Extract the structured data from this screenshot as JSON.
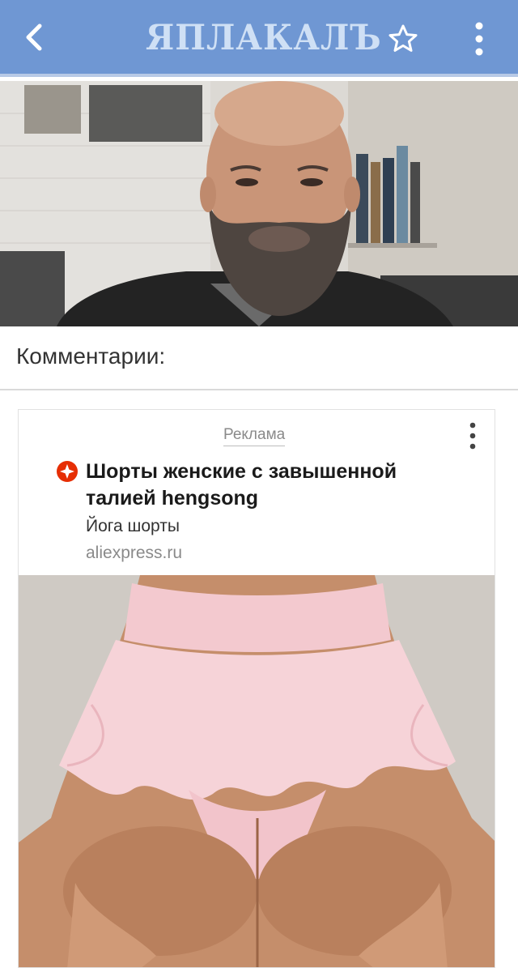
{
  "header": {
    "logo_text": "ЯПЛАКАЛЪ",
    "back_icon": "chevron-left-icon",
    "favorite_icon": "star-outline-icon",
    "menu_icon": "more-vertical-icon",
    "background_color": "#6f97d3"
  },
  "post": {
    "image_alt": "bearded man photo"
  },
  "comments": {
    "title": "Комментарии:"
  },
  "ad": {
    "label": "Реклама",
    "menu_icon": "more-vertical-icon",
    "brand_icon": "aliexpress-icon",
    "title": "Шорты женские с завышенной талией hengsong",
    "subtitle": "Йога шорты",
    "domain": "aliexpress.ru",
    "brand_color": "#e62e04"
  }
}
